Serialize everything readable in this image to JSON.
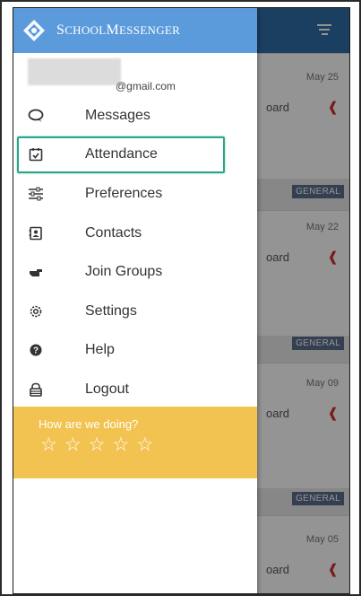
{
  "app": {
    "title_initial_1": "S",
    "title_rest_1": "CHOOL",
    "title_initial_2": "M",
    "title_rest_2": "ESSENGER"
  },
  "account": {
    "email": "@gmail.com"
  },
  "menu": {
    "items": [
      {
        "label": "Messages",
        "icon": "chat-icon"
      },
      {
        "label": "Attendance",
        "icon": "calendar-check-icon"
      },
      {
        "label": "Preferences",
        "icon": "sliders-icon"
      },
      {
        "label": "Contacts",
        "icon": "contacts-icon"
      },
      {
        "label": "Join Groups",
        "icon": "pointing-hand-icon"
      },
      {
        "label": "Settings",
        "icon": "gear-icon"
      },
      {
        "label": "Help",
        "icon": "help-icon"
      },
      {
        "label": "Logout",
        "icon": "lock-icon"
      }
    ],
    "highlighted": "Attendance"
  },
  "feedback": {
    "question": "How are we doing?",
    "star_count": 5
  },
  "background": {
    "messages": [
      {
        "date": "May 25",
        "from_fragment": "oard",
        "badge": "GENERAL"
      },
      {
        "date": "May 22",
        "from_fragment": "oard",
        "badge": "GENERAL"
      },
      {
        "date": "May 09",
        "from_fragment": "oard",
        "badge": "GENERAL"
      },
      {
        "date": "May 05",
        "from_fragment": "oard"
      }
    ]
  },
  "colors": {
    "header_bg": "#2f6da6",
    "drawer_header": "#5b9bdb",
    "feedback_bg": "#f3c351",
    "highlight": "#2aa58a",
    "flag": "#d0312d"
  }
}
